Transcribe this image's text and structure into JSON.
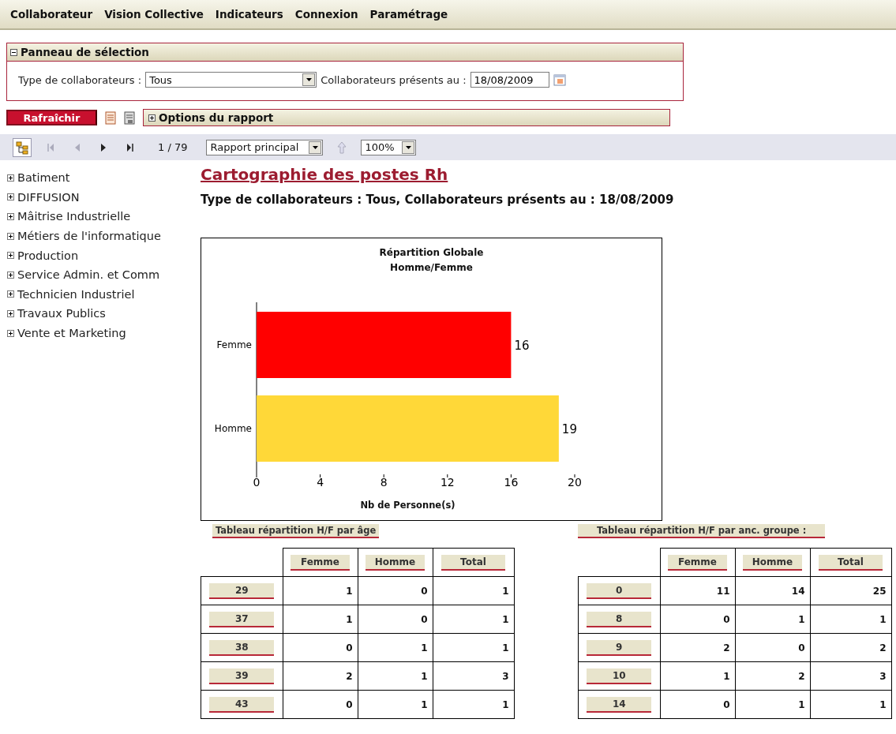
{
  "menu": [
    {
      "label": "Collaborateur"
    },
    {
      "label": "Vision Collective"
    },
    {
      "label": "Indicateurs"
    },
    {
      "label": "Connexion"
    },
    {
      "label": "Paramétrage"
    }
  ],
  "selection_panel": {
    "title": "Panneau de sélection",
    "expanded": true,
    "type_label": "Type de collaborateurs :",
    "type_value": "Tous",
    "date_label": "Collaborateurs présents au :",
    "date_value": "18/08/2009"
  },
  "actions": {
    "refresh": "Rafraîchir",
    "options_title": "Options du rapport",
    "options_expanded": false
  },
  "report_toolbar": {
    "first_disabled": true,
    "prev_disabled": true,
    "next_disabled": false,
    "last_disabled": false,
    "page": "1 / 79",
    "report": "Rapport principal",
    "zoom": "100%"
  },
  "tree": [
    {
      "label": "Batiment",
      "expanded": false
    },
    {
      "label": "DIFFUSION",
      "expanded": false
    },
    {
      "label": "Mâitrise Industrielle",
      "expanded": false
    },
    {
      "label": "Métiers de l'informatique",
      "expanded": false
    },
    {
      "label": "Production",
      "expanded": false
    },
    {
      "label": "Service Admin. et Comm",
      "expanded": false
    },
    {
      "label": "Technicien Industriel",
      "expanded": false
    },
    {
      "label": "Travaux Publics",
      "expanded": false
    },
    {
      "label": "Vente et Marketing",
      "expanded": false
    }
  ],
  "report": {
    "title": "Cartographie des postes Rh",
    "subtitle": "Type de collaborateurs : Tous, Collaborateurs présents au : 18/08/2009",
    "chart_data": {
      "type": "bar",
      "orientation": "horizontal",
      "title": "Répartition Globale Homme/Femme",
      "xlabel": "Nb de Personne(s)",
      "categories": [
        "Femme",
        "Homme"
      ],
      "data_labels": true,
      "xlim": [
        0,
        20
      ],
      "xticks": [
        0,
        4,
        8,
        12,
        16,
        20
      ],
      "series": [
        {
          "color": "#ff0000",
          "values": [
            16,
            null
          ]
        },
        {
          "color": "#ffd838",
          "values": [
            null,
            19
          ]
        }
      ]
    },
    "tables": [
      {
        "title": "Tableau répartition H/F par âge",
        "columns": [
          "Femme",
          "Homme",
          "Total"
        ],
        "rows": [
          {
            "label": "29",
            "cells": [
              "1",
              "0",
              "1"
            ]
          },
          {
            "label": "37",
            "cells": [
              "1",
              "0",
              "1"
            ]
          },
          {
            "label": "38",
            "cells": [
              "0",
              "1",
              "1"
            ]
          },
          {
            "label": "39",
            "cells": [
              "2",
              "1",
              "3"
            ]
          },
          {
            "label": "43",
            "cells": [
              "0",
              "1",
              "1"
            ]
          }
        ]
      },
      {
        "title": "Tableau répartition H/F par anc. groupe :",
        "columns": [
          "Femme",
          "Homme",
          "Total"
        ],
        "rows": [
          {
            "label": "0",
            "cells": [
              "11",
              "14",
              "25"
            ]
          },
          {
            "label": "8",
            "cells": [
              "0",
              "1",
              "1"
            ]
          },
          {
            "label": "9",
            "cells": [
              "2",
              "0",
              "2"
            ]
          },
          {
            "label": "10",
            "cells": [
              "1",
              "2",
              "3"
            ]
          },
          {
            "label": "14",
            "cells": [
              "0",
              "1",
              "1"
            ]
          }
        ]
      }
    ]
  }
}
